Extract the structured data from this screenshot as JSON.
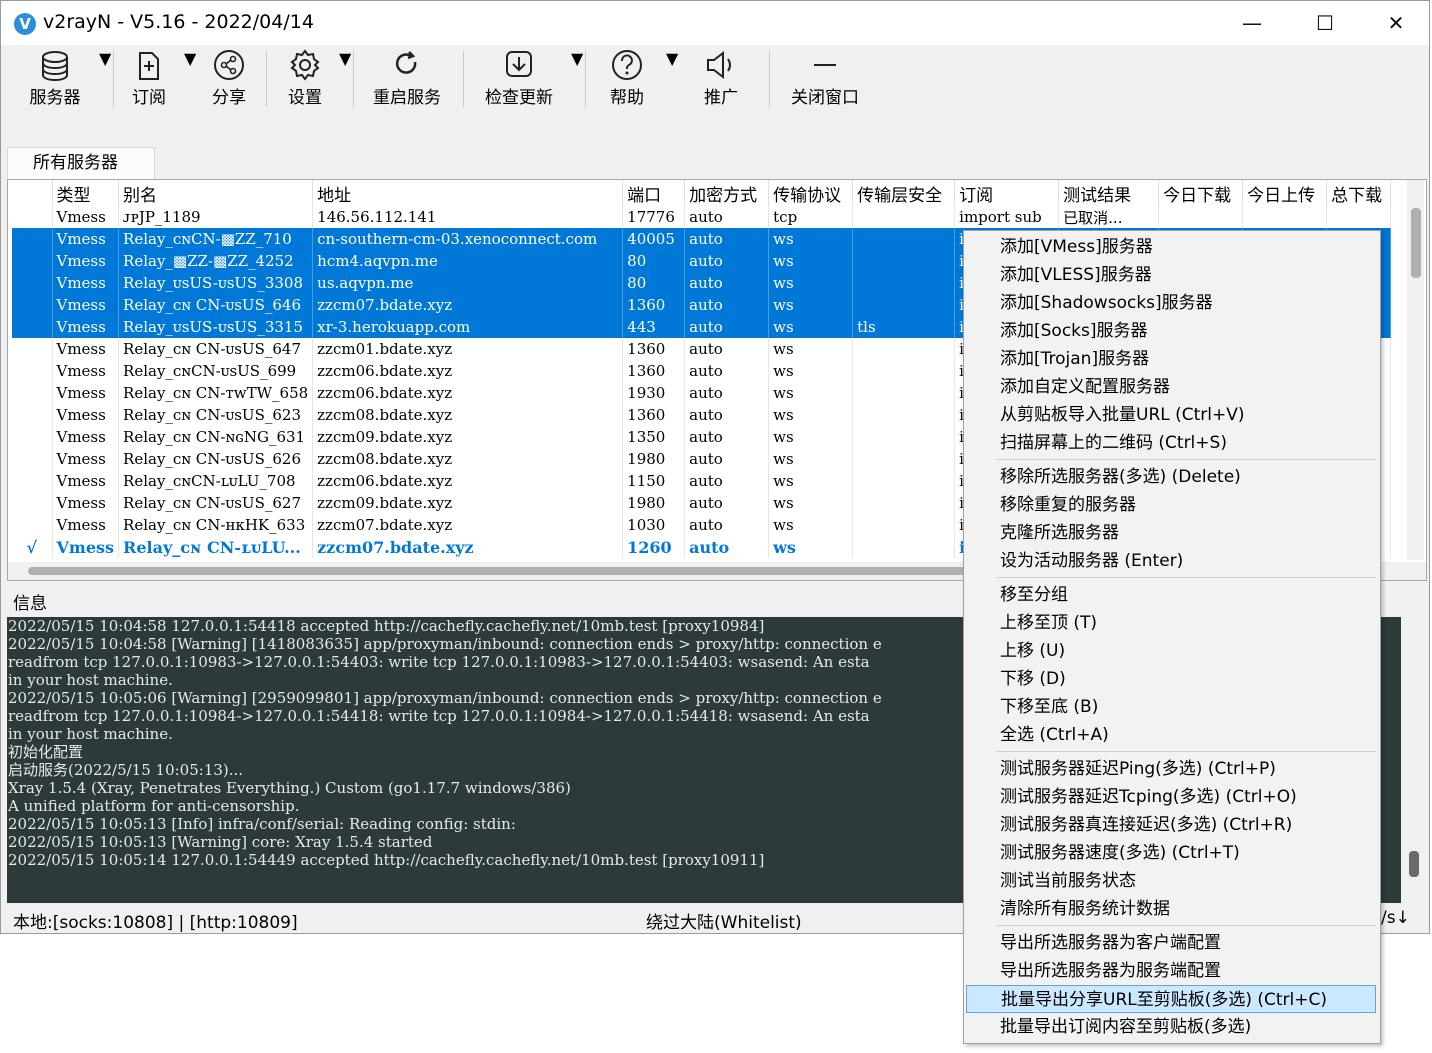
{
  "window": {
    "title": "v2rayN - V5.16 - 2022/04/14",
    "icon_letter": "V",
    "accent": "#0078d7"
  },
  "toolbar": [
    {
      "label": "服务器",
      "icon": "database-icon",
      "dropdown": true
    },
    {
      "label": "订阅",
      "icon": "subscribe-icon",
      "dropdown": true
    },
    {
      "label": "分享",
      "icon": "share-icon",
      "dropdown": false
    },
    {
      "label": "设置",
      "icon": "gear-icon",
      "dropdown": true
    },
    {
      "label": "重启服务",
      "icon": "refresh-icon",
      "dropdown": false
    },
    {
      "label": "检查更新",
      "icon": "download-icon",
      "dropdown": true
    },
    {
      "label": "帮助",
      "icon": "help-icon",
      "dropdown": true
    },
    {
      "label": "推广",
      "icon": "megaphone-icon",
      "dropdown": false
    },
    {
      "label": "关闭窗口",
      "icon": "minimize-icon",
      "dropdown": false
    }
  ],
  "tabs": {
    "all_servers": "所有服务器"
  },
  "table": {
    "columns": [
      "",
      "类型",
      "别名",
      "地址",
      "端口",
      "加密方式",
      "传输协议",
      "传输层安全",
      "订阅",
      "测试结果",
      "今日下载",
      "今日上传",
      "总下载"
    ],
    "rows": [
      {
        "check": "",
        "type": "Vmess",
        "alias": "ᴊᴘJP_1189",
        "addr": "146.56.112.141",
        "port": "17776",
        "enc": "auto",
        "net": "tcp",
        "tls": "",
        "sub": "import sub",
        "test": "已取消...",
        "state": "normal"
      },
      {
        "check": "",
        "type": "Vmess",
        "alias": "Relay_ᴄɴCN-▩ZZ_710",
        "addr": "cn-southern-cm-03.xenoconnect.com",
        "port": "40005",
        "enc": "auto",
        "net": "ws",
        "tls": "",
        "sub": "in",
        "test": "",
        "state": "sel"
      },
      {
        "check": "",
        "type": "Vmess",
        "alias": "Relay_▩ZZ-▩ZZ_4252",
        "addr": "hcm4.aqvpn.me",
        "port": "80",
        "enc": "auto",
        "net": "ws",
        "tls": "",
        "sub": "in",
        "test": "",
        "state": "sel"
      },
      {
        "check": "",
        "type": "Vmess",
        "alias": "Relay_ᴜsUS-ᴜsUS_3308",
        "addr": "us.aqvpn.me",
        "port": "80",
        "enc": "auto",
        "net": "ws",
        "tls": "",
        "sub": "in",
        "test": "",
        "state": "sel"
      },
      {
        "check": "",
        "type": "Vmess",
        "alias": "Relay_ᴄɴ CN-ᴜsUS_646",
        "addr": "zzcm07.bdate.xyz",
        "port": "1360",
        "enc": "auto",
        "net": "ws",
        "tls": "",
        "sub": "in",
        "test": "",
        "state": "sel"
      },
      {
        "check": "",
        "type": "Vmess",
        "alias": "Relay_ᴜsUS-ᴜsUS_3315",
        "addr": "xr-3.herokuapp.com",
        "port": "443",
        "enc": "auto",
        "net": "ws",
        "tls": "tls",
        "sub": "in",
        "test": "",
        "state": "sel"
      },
      {
        "check": "",
        "type": "Vmess",
        "alias": "Relay_ᴄɴ CN-ᴜsUS_647",
        "addr": "zzcm01.bdate.xyz",
        "port": "1360",
        "enc": "auto",
        "net": "ws",
        "tls": "",
        "sub": "in",
        "test": "",
        "state": "normal"
      },
      {
        "check": "",
        "type": "Vmess",
        "alias": "Relay_ᴄɴCN-ᴜsUS_699",
        "addr": "zzcm06.bdate.xyz",
        "port": "1360",
        "enc": "auto",
        "net": "ws",
        "tls": "",
        "sub": "in",
        "test": "",
        "state": "normal"
      },
      {
        "check": "",
        "type": "Vmess",
        "alias": "Relay_ᴄɴ CN-ᴛᴡTW_658",
        "addr": "zzcm06.bdate.xyz",
        "port": "1930",
        "enc": "auto",
        "net": "ws",
        "tls": "",
        "sub": "in",
        "test": "",
        "state": "normal"
      },
      {
        "check": "",
        "type": "Vmess",
        "alias": "Relay_ᴄɴ CN-ᴜsUS_623",
        "addr": "zzcm08.bdate.xyz",
        "port": "1360",
        "enc": "auto",
        "net": "ws",
        "tls": "",
        "sub": "in",
        "test": "",
        "state": "normal"
      },
      {
        "check": "",
        "type": "Vmess",
        "alias": "Relay_ᴄɴ CN-ɴɢNG_631",
        "addr": "zzcm09.bdate.xyz",
        "port": "1350",
        "enc": "auto",
        "net": "ws",
        "tls": "",
        "sub": "in",
        "test": "",
        "state": "normal"
      },
      {
        "check": "",
        "type": "Vmess",
        "alias": "Relay_ᴄɴ CN-ᴜsUS_626",
        "addr": "zzcm08.bdate.xyz",
        "port": "1980",
        "enc": "auto",
        "net": "ws",
        "tls": "",
        "sub": "in",
        "test": "",
        "state": "normal"
      },
      {
        "check": "",
        "type": "Vmess",
        "alias": "Relay_ᴄɴCN-ʟᴜLU_708",
        "addr": "zzcm06.bdate.xyz",
        "port": "1150",
        "enc": "auto",
        "net": "ws",
        "tls": "",
        "sub": "in",
        "test": "",
        "state": "normal"
      },
      {
        "check": "",
        "type": "Vmess",
        "alias": "Relay_ᴄɴ CN-ᴜsUS_627",
        "addr": "zzcm09.bdate.xyz",
        "port": "1980",
        "enc": "auto",
        "net": "ws",
        "tls": "",
        "sub": "in",
        "test": "",
        "state": "normal"
      },
      {
        "check": "",
        "type": "Vmess",
        "alias": "Relay_ᴄɴ CN-ʜᴋHK_633",
        "addr": "zzcm07.bdate.xyz",
        "port": "1030",
        "enc": "auto",
        "net": "ws",
        "tls": "",
        "sub": "in",
        "test": "",
        "state": "normal"
      },
      {
        "check": "√",
        "type": "Vmess",
        "alias": "Relay_ᴄɴ CN-ʟᴜLU...",
        "addr": "zzcm07.bdate.xyz",
        "port": "1260",
        "enc": "auto",
        "net": "ws",
        "tls": "",
        "sub": "in",
        "test": "",
        "state": "active"
      }
    ]
  },
  "info": {
    "label": "信息",
    "log": [
      "2022/05/15 10:04:58 127.0.0.1:54418 accepted http://cachefly.cachefly.net/10mb.test [proxy10984]",
      "2022/05/15 10:04:58 [Warning] [1418083635] app/proxyman/inbound: connection ends > proxy/http: connection e",
      "readfrom tcp 127.0.0.1:10983->127.0.0.1:54403: write tcp 127.0.0.1:10983->127.0.0.1:54403: wsasend: An esta",
      "in your host machine.",
      "2022/05/15 10:05:06 [Warning] [2959099801] app/proxyman/inbound: connection ends > proxy/http: connection e",
      "readfrom tcp 127.0.0.1:10984->127.0.0.1:54418: write tcp 127.0.0.1:10984->127.0.0.1:54418: wsasend: An esta",
      "in your host machine.",
      "初始化配置",
      "启动服务(2022/5/15 10:05:13)...",
      "Xray 1.5.4 (Xray, Penetrates Everything.) Custom (go1.17.7 windows/386)",
      "A unified platform for anti-censorship.",
      "2022/05/15 10:05:13 [Info] infra/conf/serial: Reading config: stdin:",
      "2022/05/15 10:05:13 [Warning] core: Xray 1.5.4 started",
      "2022/05/15 10:05:14 127.0.0.1:54449 accepted http://cachefly.cachefly.net/10mb.test [proxy10911]"
    ]
  },
  "status": {
    "local": "本地:[socks:10808] | [http:10809]",
    "routing": "绕过大陆(Whitelist)",
    "right": "/s↓"
  },
  "context_menu": {
    "groups": [
      [
        "添加[VMess]服务器",
        "添加[VLESS]服务器",
        "添加[Shadowsocks]服务器",
        "添加[Socks]服务器",
        "添加[Trojan]服务器",
        "添加自定义配置服务器",
        "从剪贴板导入批量URL (Ctrl+V)",
        "扫描屏幕上的二维码 (Ctrl+S)"
      ],
      [
        "移除所选服务器(多选) (Delete)",
        "移除重复的服务器",
        "克隆所选服务器",
        "设为活动服务器 (Enter)"
      ],
      [
        "移至分组",
        "上移至顶 (T)",
        "上移 (U)",
        "下移 (D)",
        "下移至底 (B)",
        "全选 (Ctrl+A)"
      ],
      [
        "测试服务器延迟Ping(多选) (Ctrl+P)",
        "测试服务器延迟Tcping(多选) (Ctrl+O)",
        "测试服务器真连接延迟(多选) (Ctrl+R)",
        "测试服务器速度(多选) (Ctrl+T)",
        "测试当前服务状态",
        "清除所有服务统计数据"
      ],
      [
        "导出所选服务器为客户端配置",
        "导出所选服务器为服务端配置",
        "批量导出分享URL至剪贴板(多选) (Ctrl+C)",
        "批量导出订阅内容至剪贴板(多选)"
      ]
    ],
    "highlighted": "批量导出分享URL至剪贴板(多选) (Ctrl+C)"
  }
}
